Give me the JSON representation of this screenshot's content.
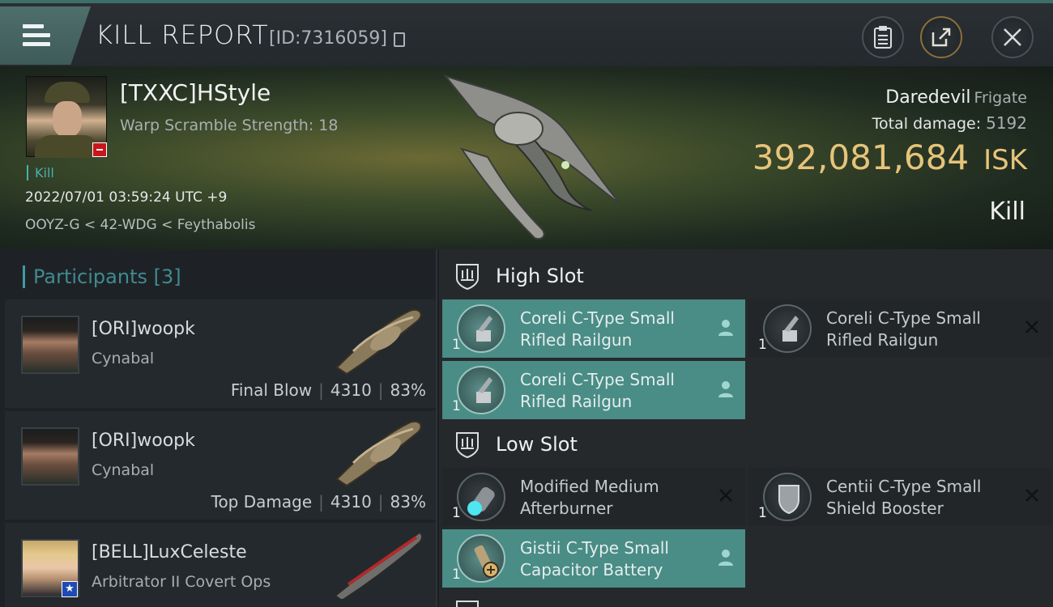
{
  "topbar": {
    "title": "KILL REPORT",
    "report_id": "[ID:7316059]"
  },
  "victim": {
    "name": "[TXXC]HStyle",
    "warp_scramble": "Warp Scramble Strength: 18",
    "tag": "Kill",
    "datetime": "2022/07/01 03:59:24 UTC +9",
    "location": "OOYZ-G < 42-WDG < Feythabolis",
    "ship_name": "Daredevil",
    "ship_class": "Frigate",
    "total_damage_label": "Total damage:",
    "total_damage_value": "5192",
    "isk_value": "392,081,684",
    "isk_unit": "ISK",
    "outcome": "Kill"
  },
  "participants": {
    "title": "Participants",
    "count": "[3]",
    "rows": [
      {
        "name": "[ORI]woopk",
        "ship": "Cynabal",
        "role": "Final Blow",
        "damage": "4310",
        "percent": "83%"
      },
      {
        "name": "[ORI]woopk",
        "ship": "Cynabal",
        "role": "Top Damage",
        "damage": "4310",
        "percent": "83%"
      },
      {
        "name": "[BELL]LuxCeleste",
        "ship": "Arbitrator II Covert Ops"
      }
    ]
  },
  "fitting": {
    "high_slot_label": "High Slot",
    "low_slot_label": "Low Slot",
    "high": [
      {
        "line1": "Coreli C-Type Small",
        "line2": "Rifled Railgun",
        "qty": "1",
        "state": "dropped",
        "icon": "railgun-icon"
      },
      {
        "line1": "Coreli C-Type Small",
        "line2": "Rifled Railgun",
        "qty": "1",
        "state": "destroyed",
        "icon": "railgun-icon"
      },
      {
        "line1": "Coreli C-Type Small",
        "line2": "Rifled Railgun",
        "qty": "1",
        "state": "dropped",
        "icon": "railgun-icon"
      }
    ],
    "low": [
      {
        "line1": "Modified Medium",
        "line2": "Afterburner",
        "qty": "1",
        "state": "destroyed",
        "icon": "afterburner-icon"
      },
      {
        "line1": "Centii C-Type Small",
        "line2": "Shield Booster",
        "qty": "1",
        "state": "destroyed",
        "icon": "shield-booster-icon"
      },
      {
        "line1": "Gistii C-Type Small",
        "line2": "Capacitor Battery",
        "qty": "1",
        "state": "dropped",
        "icon": "capacitor-battery-icon"
      }
    ]
  },
  "colors": {
    "accent_teal": "#4a8c86",
    "isk_gold": "#e7c47a",
    "kill_tag": "#4ab0b0"
  }
}
